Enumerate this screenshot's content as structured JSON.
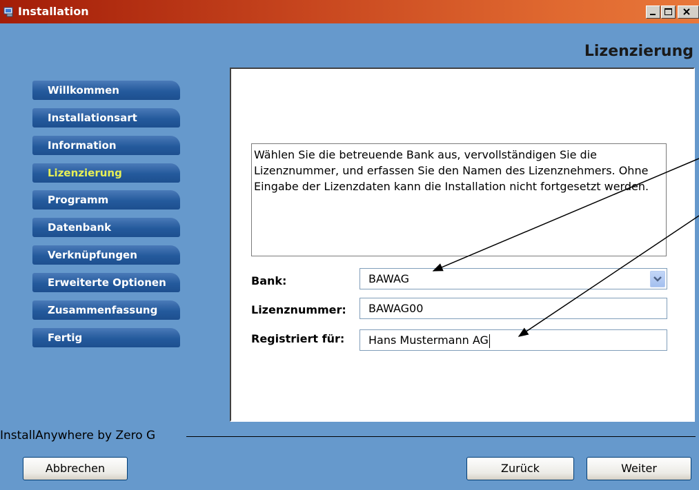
{
  "window": {
    "title": "Installation",
    "app_icon": "installer-icon",
    "controls": {
      "minimize": "minimize-icon",
      "maximize": "maximize-icon",
      "close": "close-icon"
    }
  },
  "page": {
    "heading": "Lizenzierung"
  },
  "nav": {
    "items": [
      {
        "label": "Willkommen"
      },
      {
        "label": "Installationsart"
      },
      {
        "label": "Information"
      },
      {
        "label": "Lizenzierung",
        "active": true
      },
      {
        "label": "Programm"
      },
      {
        "label": "Datenbank"
      },
      {
        "label": "Verknüpfungen"
      },
      {
        "label": "Erweiterte Optionen"
      },
      {
        "label": "Zusammenfassung"
      },
      {
        "label": "Fertig"
      }
    ],
    "active_color": "#e6f056"
  },
  "content": {
    "description": "Wählen Sie die betreuende Bank aus, vervollständigen Sie die Lizenznummer, und erfassen Sie den Namen des Lizenznehmers. Ohne Eingabe der Lizenzdaten kann die Installation nicht fortgesetzt werden.",
    "fields": {
      "bank": {
        "label": "Bank:",
        "value": "BAWAG"
      },
      "license": {
        "label": "Lizenznummer:",
        "value": "BAWAG00"
      },
      "registered": {
        "label": "Registriert für:",
        "value": "Hans Mustermann AG"
      }
    }
  },
  "footer": {
    "branding": "InstallAnywhere by Zero G",
    "cancel_label": "Abbrechen",
    "back_label": "Zurück",
    "next_label": "Weiter"
  },
  "colors": {
    "titlebar": "#c0401a",
    "background": "#6699cc",
    "nav_button": "#245a9c"
  }
}
